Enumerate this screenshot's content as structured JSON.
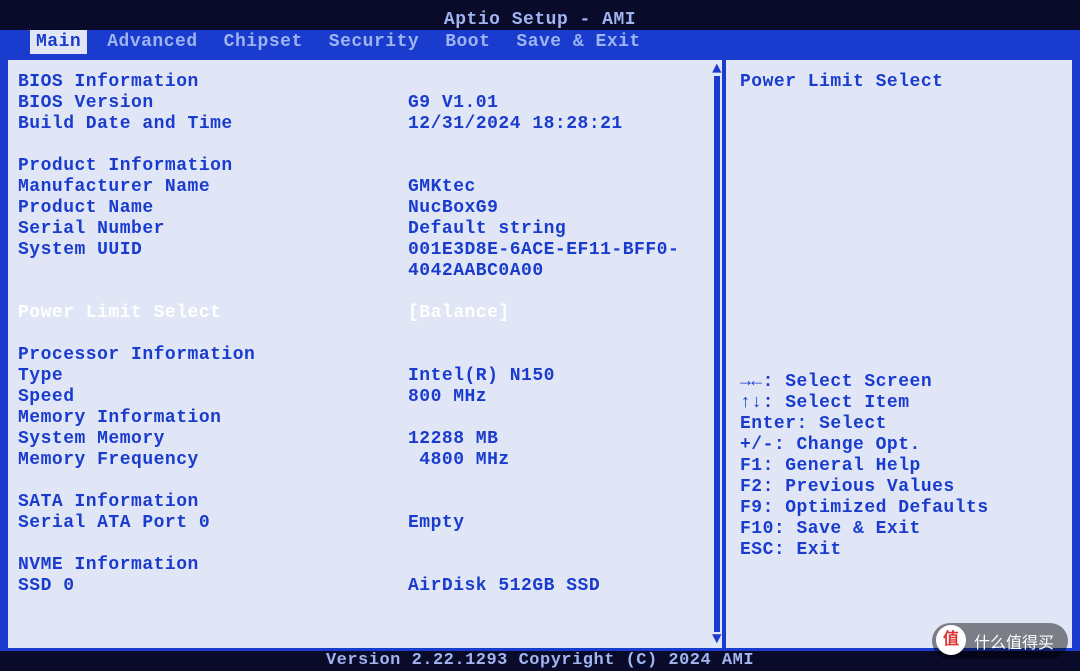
{
  "title": "Aptio Setup - AMI",
  "tabs": [
    "Main",
    "Advanced",
    "Chipset",
    "Security",
    "Boot",
    "Save & Exit"
  ],
  "activeTab": 0,
  "main": {
    "bios_info_hdr": "BIOS Information",
    "bios_version_label": "BIOS Version",
    "bios_version_value": "G9 V1.01",
    "build_date_label": "Build Date and Time",
    "build_date_value": "12/31/2024 18:28:21",
    "product_info_hdr": "Product Information",
    "manufacturer_label": "Manufacturer Name",
    "manufacturer_value": "GMKtec",
    "product_name_label": "Product Name",
    "product_name_value": "NucBoxG9",
    "serial_label": "Serial Number",
    "serial_value": "Default string",
    "uuid_label": "System UUID",
    "uuid_value_1": "001E3D8E-6ACE-EF11-BFF0-",
    "uuid_value_2": "4042AABC0A00",
    "power_limit_label": "Power Limit Select",
    "power_limit_value": "[Balance]",
    "processor_info_hdr": "Processor Information",
    "cpu_type_label": "Type",
    "cpu_type_value": "Intel(R) N150",
    "cpu_speed_label": "Speed",
    "cpu_speed_value": "800 MHz",
    "memory_info_hdr": "Memory Information",
    "sys_mem_label": "System Memory",
    "sys_mem_value": "12288 MB",
    "mem_freq_label": "Memory Frequency",
    "mem_freq_value": " 4800 MHz",
    "sata_info_hdr": "SATA Information",
    "sata_port0_label": "Serial ATA Port 0",
    "sata_port0_value": "Empty",
    "nvme_info_hdr": "NVME Information",
    "ssd0_label": "SSD 0",
    "ssd0_value": "AirDisk 512GB SSD"
  },
  "help": {
    "title": "Power Limit Select",
    "keys": [
      "→←: Select Screen",
      "↑↓: Select Item",
      "Enter: Select",
      "+/-: Change Opt.",
      "F1: General Help",
      "F2: Previous Values",
      "F9: Optimized Defaults",
      "F10: Save & Exit",
      "ESC: Exit"
    ]
  },
  "footer": "Version 2.22.1293 Copyright (C) 2024 AMI",
  "watermark": "什么值得买"
}
